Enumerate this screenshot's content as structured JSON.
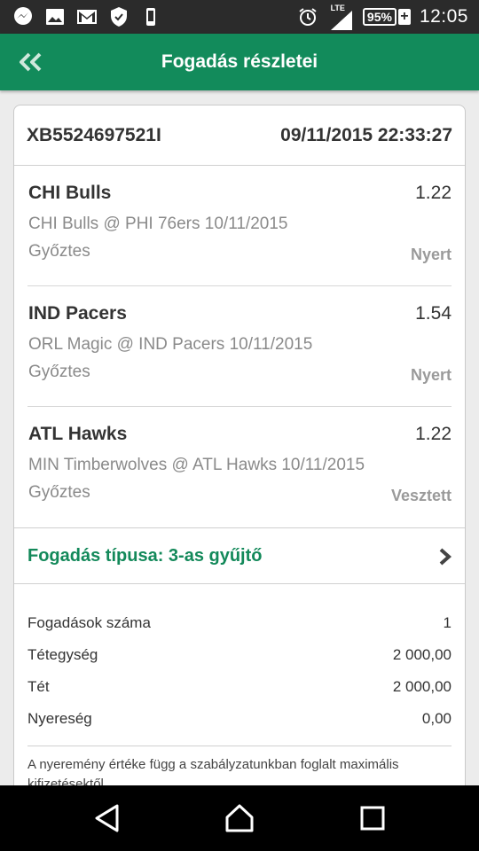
{
  "status_bar": {
    "time": "12:05",
    "battery": "95%",
    "network": "LTE",
    "notification_icons": [
      "messenger-icon",
      "image-icon",
      "gmail-icon",
      "shield-icon",
      "phone-icon"
    ]
  },
  "app_bar": {
    "title": "Fogadás részletei",
    "back_icon": "double-chevron-left-icon"
  },
  "ticket": {
    "id": "XB5524697521I",
    "datetime": "09/11/2015 22:33:27"
  },
  "bets": [
    {
      "team": "CHI Bulls",
      "odds": "1.22",
      "match": "CHI Bulls @ PHI 76ers 10/11/2015",
      "type": "Győztes",
      "result": "Nyert"
    },
    {
      "team": "IND Pacers",
      "odds": "1.54",
      "match": "ORL Magic @ IND Pacers 10/11/2015",
      "type": "Győztes",
      "result": "Nyert"
    },
    {
      "team": "ATL Hawks",
      "odds": "1.22",
      "match": "MIN Timberwolves @ ATL Hawks 10/11/2015",
      "type": "Győztes",
      "result": "Vesztett"
    }
  ],
  "bet_type": {
    "label": "Fogadás típusa: 3-as gyűjtő"
  },
  "summary": [
    {
      "label": "Fogadások száma",
      "value": "1"
    },
    {
      "label": "Tétegység",
      "value": "2 000,00"
    },
    {
      "label": "Tét",
      "value": "2 000,00"
    },
    {
      "label": "Nyereség",
      "value": "0,00"
    }
  ],
  "note": "A nyeremény értéke függ a szabályzatunkban foglalt maximális kifizetésektől.",
  "colors": {
    "brand_green": "#128b5b",
    "status_bar": "#2b2b2b",
    "accent_text": "#13895a"
  }
}
